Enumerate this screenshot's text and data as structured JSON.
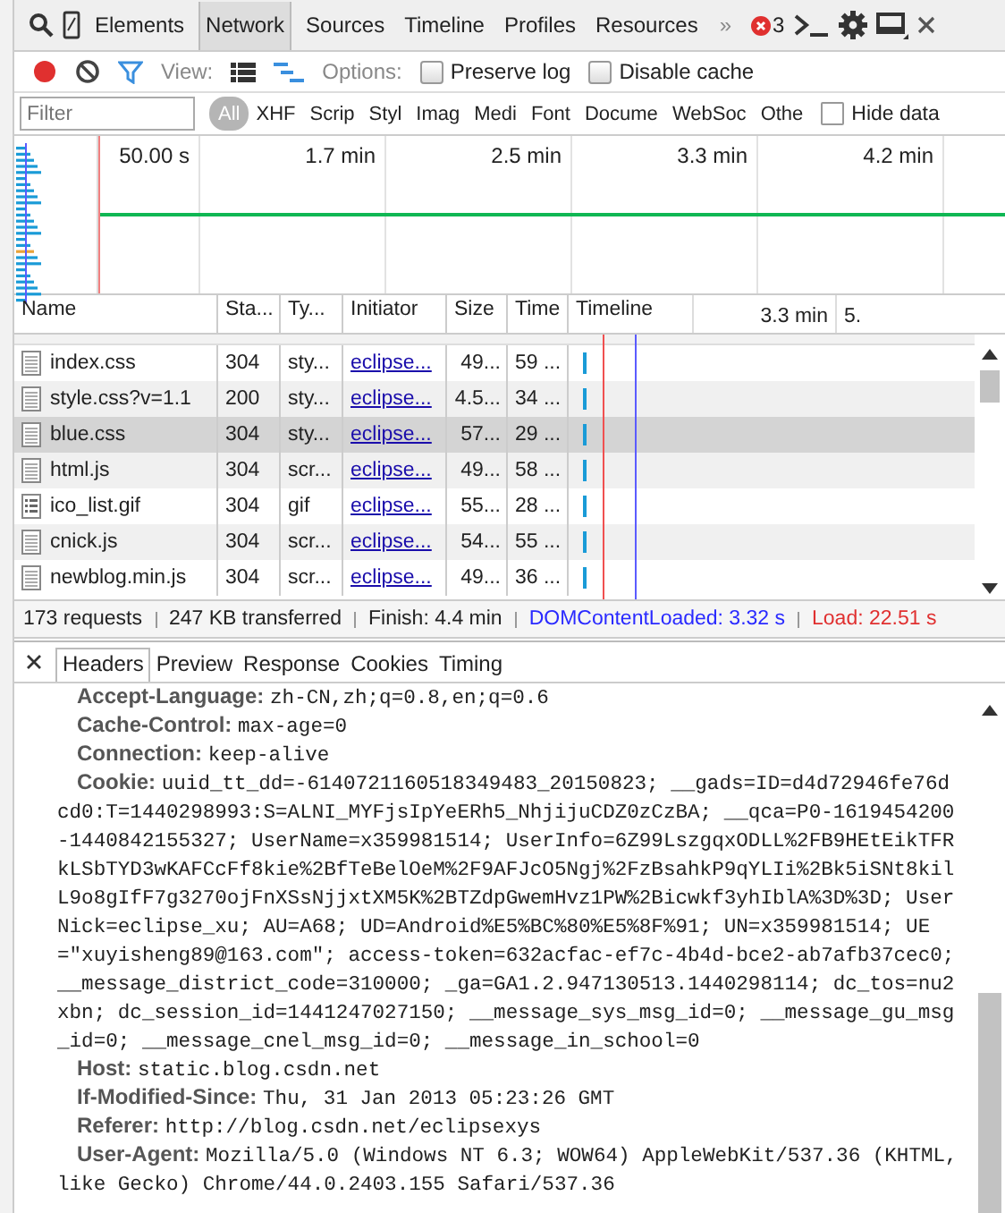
{
  "toolbar": {
    "tabs": [
      {
        "label": "Elements",
        "selected": false
      },
      {
        "label": "Network",
        "selected": true
      },
      {
        "label": "Sources",
        "selected": false
      },
      {
        "label": "Timeline",
        "selected": false
      },
      {
        "label": "Profiles",
        "selected": false
      },
      {
        "label": "Resources",
        "selected": false
      }
    ],
    "overflow": "»",
    "error_count": "3"
  },
  "network_toolbar": {
    "recording": true,
    "view_label": "View:",
    "options_label": "Options:",
    "checkboxes": [
      {
        "label": "Preserve log",
        "checked": false
      },
      {
        "label": "Disable cache",
        "checked": false
      }
    ]
  },
  "filter_bar": {
    "placeholder": "Filter",
    "types": [
      {
        "label": "All",
        "selected": true
      },
      {
        "label": "XHF",
        "selected": false
      },
      {
        "label": "Scrip",
        "selected": false
      },
      {
        "label": "Styl",
        "selected": false
      },
      {
        "label": "Imag",
        "selected": false
      },
      {
        "label": "Medi",
        "selected": false
      },
      {
        "label": "Font",
        "selected": false
      },
      {
        "label": "Docume",
        "selected": false
      },
      {
        "label": "WebSoc",
        "selected": false
      },
      {
        "label": "Othe",
        "selected": false
      }
    ],
    "hide_data": {
      "label": "Hide data",
      "checked": false
    }
  },
  "overview": {
    "ticks": [
      "50.00 s",
      "1.7 min",
      "2.5 min",
      "3.3 min",
      "4.2 min"
    ]
  },
  "table": {
    "columns": [
      "Name",
      "Sta...",
      "Ty...",
      "Initiator",
      "Size",
      "Time",
      "Timeline"
    ],
    "timeline_ticks": [
      "3.3 min",
      "5."
    ],
    "rows": [
      {
        "name": "index.css",
        "kind": "document",
        "status": "304",
        "type": "sty...",
        "initiator": "eclipse...",
        "size": "49...",
        "time": "59 ...",
        "selected": false
      },
      {
        "name": "style.css?v=1.1",
        "kind": "document",
        "status": "200",
        "type": "sty...",
        "initiator": "eclipse...",
        "size": "4.5...",
        "time": "34 ...",
        "selected": false
      },
      {
        "name": "blue.css",
        "kind": "document",
        "status": "304",
        "type": "sty...",
        "initiator": "eclipse...",
        "size": "57...",
        "time": "29 ...",
        "selected": true
      },
      {
        "name": "html.js",
        "kind": "document",
        "status": "304",
        "type": "scr...",
        "initiator": "eclipse...",
        "size": "49...",
        "time": "58 ...",
        "selected": false
      },
      {
        "name": "ico_list.gif",
        "kind": "image",
        "status": "304",
        "type": "gif",
        "initiator": "eclipse...",
        "size": "55...",
        "time": "28 ...",
        "selected": false
      },
      {
        "name": "cnick.js",
        "kind": "document",
        "status": "304",
        "type": "scr...",
        "initiator": "eclipse...",
        "size": "54...",
        "time": "55 ...",
        "selected": false
      },
      {
        "name": "newblog.min.js",
        "kind": "document",
        "status": "304",
        "type": "scr...",
        "initiator": "eclipse...",
        "size": "49...",
        "time": "36 ...",
        "selected": false
      }
    ]
  },
  "status_bar": [
    {
      "text": "173 requests",
      "kind": "plain"
    },
    {
      "text": "247 KB transferred",
      "kind": "plain"
    },
    {
      "text": "Finish: 4.4 min",
      "kind": "plain"
    },
    {
      "text": "DOMContentLoaded: 3.32 s",
      "kind": "dom"
    },
    {
      "text": "Load: 22.51 s",
      "kind": "load"
    }
  ],
  "details": {
    "tabs": [
      {
        "label": "Headers",
        "selected": true
      },
      {
        "label": "Preview",
        "selected": false
      },
      {
        "label": "Response",
        "selected": false
      },
      {
        "label": "Cookies",
        "selected": false
      },
      {
        "label": "Timing",
        "selected": false
      }
    ],
    "headers": [
      {
        "name": "Accept-Language:",
        "value": "zh-CN,zh;q=0.8,en;q=0.6"
      },
      {
        "name": "Cache-Control:",
        "value": "max-age=0"
      },
      {
        "name": "Connection:",
        "value": "keep-alive"
      },
      {
        "name": "Cookie:",
        "value": "uuid_tt_dd=-6140721160518349483_20150823; __gads=ID=d4d72946fe76dcd0:T=1440298993:S=ALNI_MYFjsIpYeERh5_NhjijuCDZ0zCzBA; __qca=P0-1619454200-1440842155327; UserName=x359981514; UserInfo=6Z99LszgqxODLL%2FB9HEtEikTFRkLSbTYD3wKAFCcFf8kie%2BfTeBelOeM%2F9AFJcO5Ngj%2FzBsahkP9qYLIi%2Bk5iSNt8kilL9o8gIfF7g3270ojFnXSsNjjxtXM5K%2BTZdpGwemHvz1PW%2Bicwkf3yhIblA%3D%3D; UserNick=eclipse_xu; AU=A68; UD=Android%E5%BC%80%E5%8F%91; UN=x359981514; UE=\"xuyisheng89@163.com\"; access-token=632acfac-ef7c-4b4d-bce2-ab7afb37cec0; __message_district_code=310000; _ga=GA1.2.947130513.1440298114; dc_tos=nu2xbn; dc_session_id=1441247027150; __message_sys_msg_id=0; __message_gu_msg_id=0; __message_cnel_msg_id=0; __message_in_school=0"
      },
      {
        "name": "Host:",
        "value": "static.blog.csdn.net"
      },
      {
        "name": "If-Modified-Since:",
        "value": "Thu, 31 Jan 2013 05:23:26 GMT"
      },
      {
        "name": "Referer:",
        "value": "http://blog.csdn.net/eclipsexys"
      },
      {
        "name": "User-Agent:",
        "value": "Mozilla/5.0 (Windows NT 6.3; WOW64) AppleWebKit/537.36 (KHTML, like Gecko) Chrome/44.0.2403.155 Safari/537.36"
      }
    ]
  }
}
